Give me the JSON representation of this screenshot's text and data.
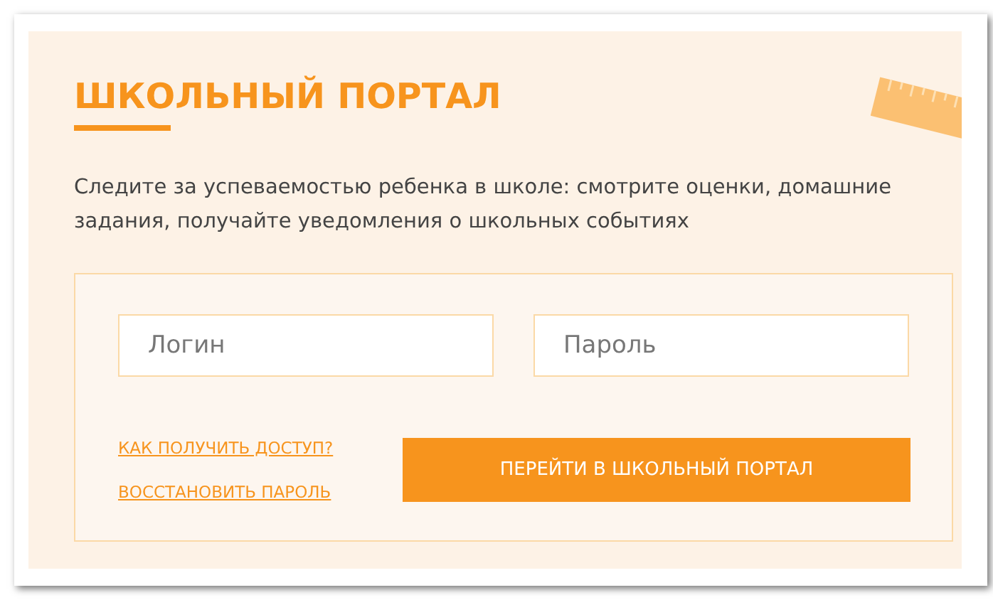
{
  "title": "ШКОЛЬНЫЙ ПОРТАЛ",
  "description": "Следите за успеваемостью ребенка в школе: смотрите оценки, домашние задания, получайте уведомления о школьных событиях",
  "form": {
    "fields": [
      {
        "placeholder": "Логин"
      },
      {
        "placeholder": "Пароль"
      }
    ],
    "links": [
      "КАК ПОЛУЧИТЬ ДОСТУП?",
      "ВОССТАНОВИТЬ ПАРОЛЬ"
    ],
    "submit": "ПЕРЕЙТИ В ШКОЛЬНЫЙ ПОРТАЛ"
  }
}
